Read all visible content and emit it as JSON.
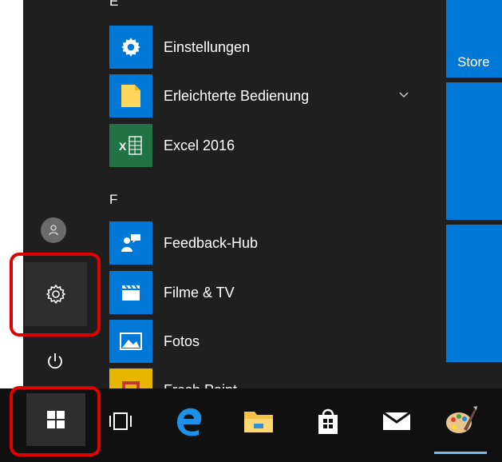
{
  "start_menu": {
    "section_letters": {
      "e": "E",
      "f": "F"
    },
    "apps": [
      {
        "label": "Einstellungen",
        "icon": "gear-icon",
        "color": "#0078d7"
      },
      {
        "label": "Erleichterte Bedienung",
        "icon": "folder-icon",
        "color": "#0078d7",
        "expandable": true
      },
      {
        "label": "Excel 2016",
        "icon": "excel-icon",
        "color": "#217346"
      },
      {
        "label": "Feedback-Hub",
        "icon": "feedback-icon",
        "color": "#0078d7"
      },
      {
        "label": "Filme & TV",
        "icon": "clapper-icon",
        "color": "#0078d7"
      },
      {
        "label": "Fotos",
        "icon": "photo-icon",
        "color": "#0078d7"
      },
      {
        "label": "Fresh Paint",
        "icon": "paint-icon",
        "color": "#e8b600"
      }
    ],
    "tiles": [
      {
        "label": "Store"
      },
      {
        "label": ""
      },
      {
        "label": ""
      }
    ],
    "rail": {
      "user": "user-icon",
      "settings": "gear-icon",
      "power": "power-icon"
    }
  },
  "taskbar": {
    "items": [
      "windows-start-icon",
      "task-view-icon",
      "edge-icon",
      "file-explorer-icon",
      "store-icon",
      "mail-icon",
      "fresh-paint-icon"
    ]
  },
  "colors": {
    "accent": "#0078d7",
    "highlight": "#e00000",
    "background": "#1f1f1f"
  }
}
